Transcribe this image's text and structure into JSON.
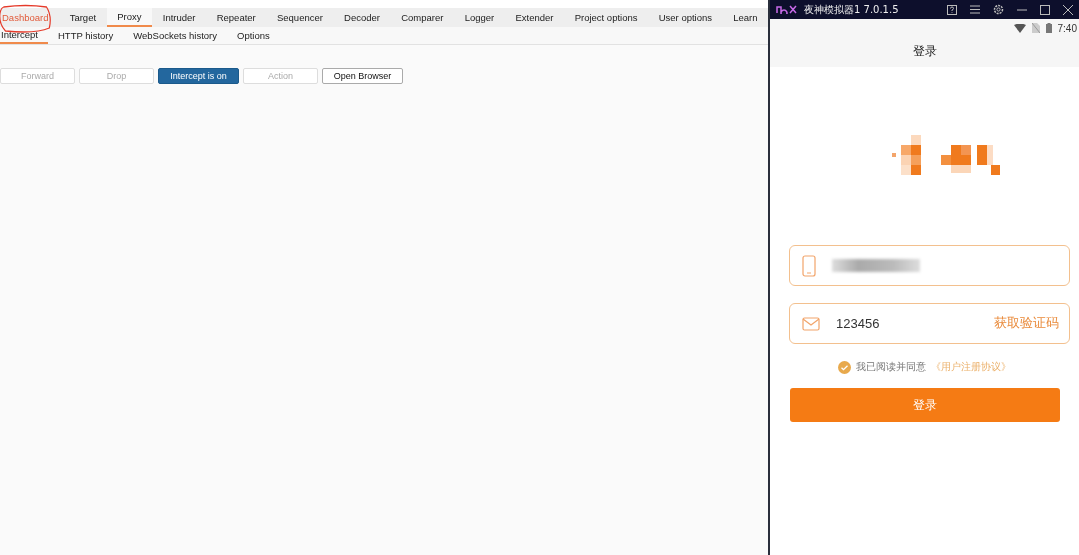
{
  "burp": {
    "tabs": [
      {
        "label": "Dashboard",
        "selected": false,
        "circled": true
      },
      {
        "label": "Target",
        "selected": false,
        "circled": false
      },
      {
        "label": "Proxy",
        "selected": true,
        "circled": false
      },
      {
        "label": "Intruder",
        "selected": false,
        "circled": false
      },
      {
        "label": "Repeater",
        "selected": false,
        "circled": false
      },
      {
        "label": "Sequencer",
        "selected": false,
        "circled": false
      },
      {
        "label": "Decoder",
        "selected": false,
        "circled": false
      },
      {
        "label": "Comparer",
        "selected": false,
        "circled": false
      },
      {
        "label": "Logger",
        "selected": false,
        "circled": false
      },
      {
        "label": "Extender",
        "selected": false,
        "circled": false
      },
      {
        "label": "Project options",
        "selected": false,
        "circled": false
      },
      {
        "label": "User options",
        "selected": false,
        "circled": false
      },
      {
        "label": "Learn",
        "selected": false,
        "circled": false
      }
    ],
    "subtabs": [
      {
        "label": "Intercept",
        "selected": true
      },
      {
        "label": "HTTP history",
        "selected": false
      },
      {
        "label": "WebSockets history",
        "selected": false
      },
      {
        "label": "Options",
        "selected": false
      }
    ],
    "buttons": [
      {
        "label": "Forward",
        "disabled": true,
        "on": false
      },
      {
        "label": "Drop",
        "disabled": true,
        "on": false
      },
      {
        "label": "Intercept is on",
        "disabled": false,
        "on": true
      },
      {
        "label": "Action",
        "disabled": true,
        "on": false
      },
      {
        "label": "Open Browser",
        "disabled": false,
        "on": false
      }
    ]
  },
  "emulator": {
    "title": "夜神模拟器1 7.0.1.5",
    "status_time": "7:40",
    "screen_title": "登录",
    "phone_field": {
      "redacted": true
    },
    "code_field": {
      "value": "123456",
      "action": "获取验证码"
    },
    "agreement": {
      "checked": true,
      "text": "我已阅读并同意",
      "link": "《用户注册协议》"
    },
    "submit": "登录"
  }
}
